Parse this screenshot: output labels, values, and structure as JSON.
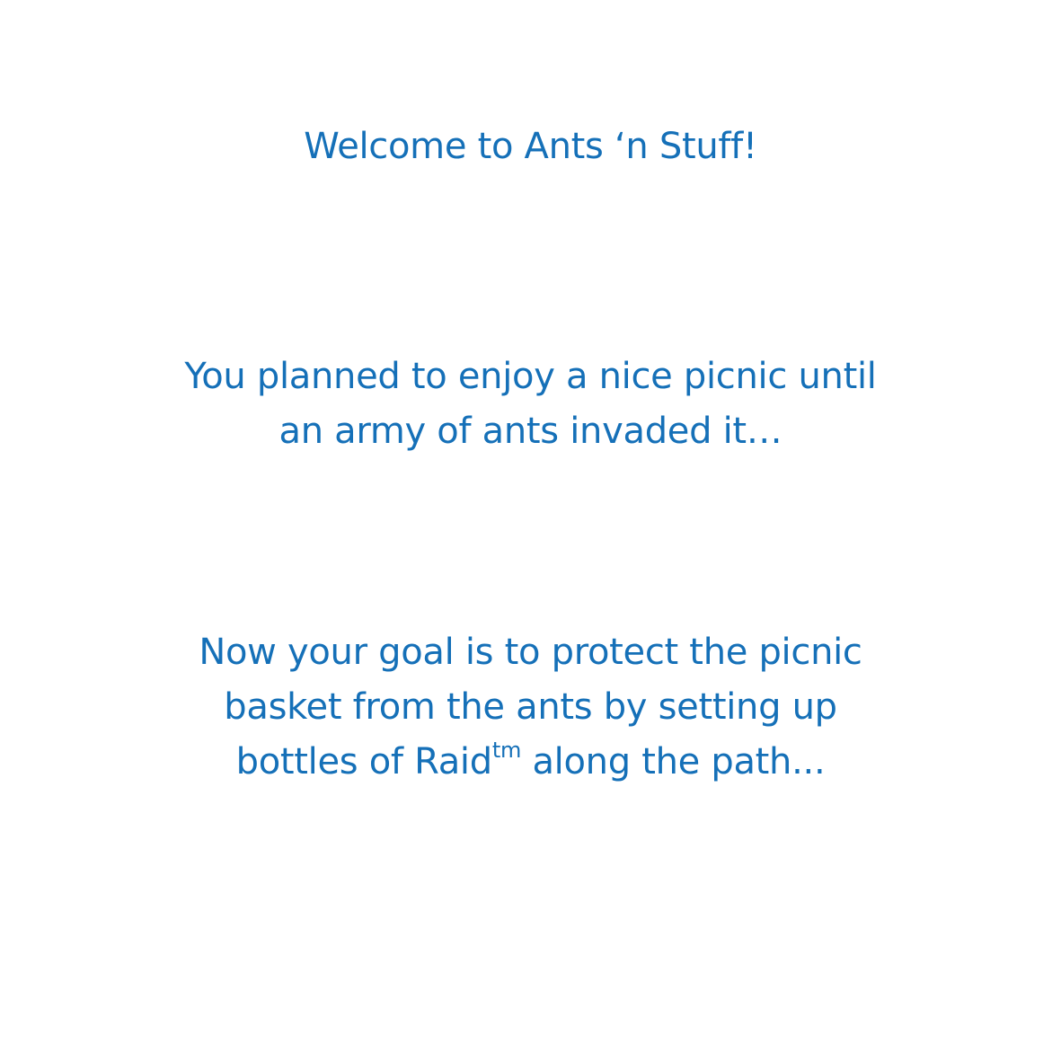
{
  "intro": {
    "title": "Welcome to Ants ‘n Stuff!",
    "story_lines": [
      "You planned to enjoy a nice picnic until",
      "an army of ants invaded it…"
    ],
    "goal_lines": [
      "Now your goal is to protect the picnic",
      "basket from the ants by setting up"
    ],
    "goal_last_line": {
      "before": "bottles of Raid",
      "superscript": "tm",
      "after": " along the path..."
    }
  },
  "colors": {
    "text": "#1570b8",
    "background": "#ffffff"
  }
}
